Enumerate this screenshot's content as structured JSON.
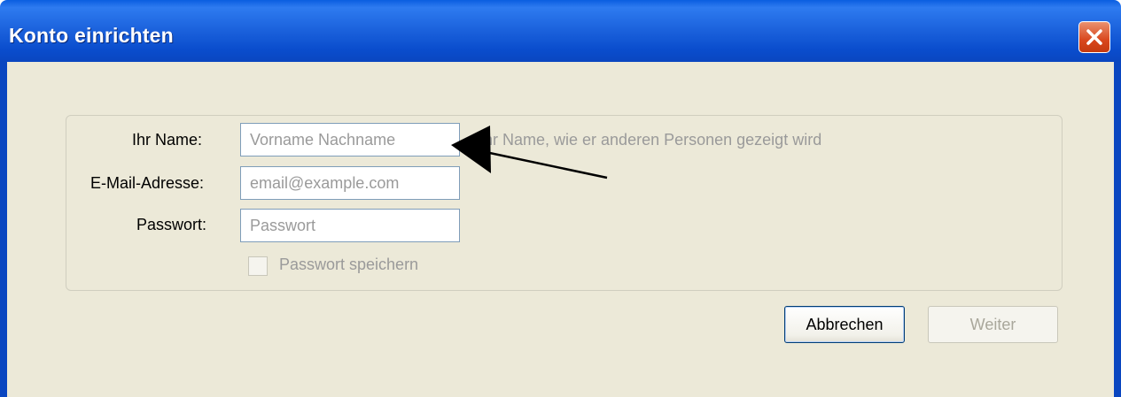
{
  "window": {
    "title": "Konto einrichten"
  },
  "form": {
    "name_label": "Ihr Name:",
    "name_placeholder": "Vorname Nachname",
    "name_hint": "Ihr Name, wie er anderen Personen gezeigt wird",
    "email_label": "E-Mail-Adresse:",
    "email_placeholder": "email@example.com",
    "password_label": "Passwort:",
    "password_placeholder": "Passwort",
    "remember_password_label": "Passwort speichern",
    "remember_password_checked": false
  },
  "buttons": {
    "cancel": "Abbrechen",
    "next": "Weiter"
  },
  "icons": {
    "close": "close-icon",
    "arrow": "arrow-annotation"
  },
  "colors": {
    "titlebar": "#0a5ee0",
    "client": "#ece9d8",
    "close": "#d9471d"
  }
}
